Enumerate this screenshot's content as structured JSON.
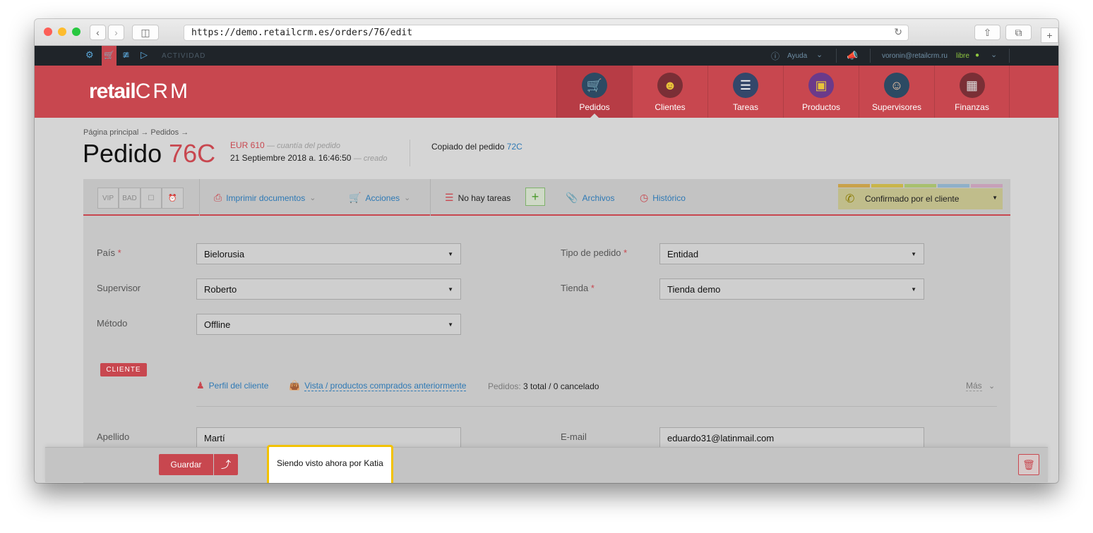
{
  "browser": {
    "url": "https://demo.retailcrm.es/orders/76/edit"
  },
  "topbar": {
    "activity_label": "ACTIVIDAD",
    "help_label": "Ayuda",
    "user_email": "voronin@retailcrm.ru",
    "user_status": "libre"
  },
  "header": {
    "logo_retail": "retail",
    "logo_crm": "CRM",
    "nav": [
      {
        "label": "Pedidos",
        "icon": "cart-icon"
      },
      {
        "label": "Clientes",
        "icon": "customer-avatar-icon"
      },
      {
        "label": "Tareas",
        "icon": "tasks-icon"
      },
      {
        "label": "Productos",
        "icon": "box-icon"
      },
      {
        "label": "Supervisores",
        "icon": "supervisor-avatar-icon"
      },
      {
        "label": "Finanzas",
        "icon": "finance-icon"
      }
    ]
  },
  "page": {
    "breadcrumb": "Página principal → Pedidos →",
    "title_prefix": "Pedido",
    "order_number": "76C",
    "amount": "EUR 610",
    "amount_note": "— cuantía del pedido",
    "created_date": "21 Septiembre 2018 a. 16:46:50",
    "created_note": "— creado",
    "copied_label": "Copiado del pedido",
    "copied_link": "72C"
  },
  "toolbar": {
    "tags": [
      "VIP",
      "BAD"
    ],
    "print_label": "Imprimir documentos",
    "actions_label": "Acciones",
    "tasks_label": "No hay tareas",
    "files_label": "Archivos",
    "history_label": "Histórico",
    "status_label": "Confirmado por el cliente",
    "status_flag_colors": [
      "#c9a24a",
      "#c9b54a",
      "#a8c06e",
      "#8fb0c8",
      "#c7a0b8"
    ]
  },
  "form": {
    "country_label": "País",
    "country_value": "Bielorusia",
    "supervisor_label": "Supervisor",
    "supervisor_value": "Roberto",
    "method_label": "Método",
    "method_value": "Offline",
    "order_type_label": "Tipo de pedido",
    "order_type_value": "Entidad",
    "store_label": "Tienda",
    "store_value": "Tienda demo"
  },
  "client": {
    "badge": "CLIENTE",
    "profile_link": "Perfil del cliente",
    "purchases_link": "Vista / productos comprados anteriormente",
    "orders_label": "Pedidos:",
    "orders_value": "3 total / 0 cancelado",
    "more_label": "Más",
    "lastname_label": "Apellido",
    "lastname_value": "Martí",
    "email_label": "E-mail",
    "email_value": "eduardo31@latinmail.com"
  },
  "bottom": {
    "save_label": "Guardar",
    "viewing_text": "Siendo visto ahora por Katia"
  }
}
